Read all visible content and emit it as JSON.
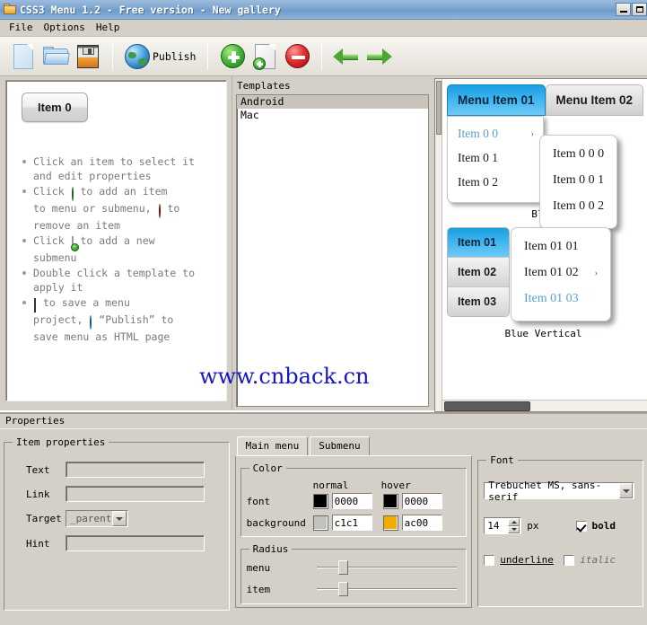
{
  "window": {
    "title": "CSS3 Menu 1.2 - Free version - New gallery",
    "icon": "folder-icon",
    "minimize_label": "minimize-icon",
    "maximize_label": "maximize-icon"
  },
  "menubar": {
    "items": [
      "File",
      "Options",
      "Help"
    ]
  },
  "toolbar": {
    "new_icon": "new-document-icon",
    "open_icon": "open-folder-icon",
    "save_icon": "save-disk-icon",
    "publish_icon": "globe-icon",
    "publish_label": "Publish",
    "add_item_icon": "add-item-icon",
    "add_submenu_icon": "add-submenu-icon",
    "remove_item_icon": "remove-item-icon",
    "back_icon": "arrow-left-icon",
    "forward_icon": "arrow-right-icon"
  },
  "help_panel": {
    "preview_button": "Item 0",
    "tips": [
      {
        "parts": [
          "Click an item to select it and edit properties"
        ]
      },
      {
        "parts": [
          "Click ",
          "[add-icon]",
          " to add an item to menu or submenu, ",
          "[remove-icon]",
          " to remove an item"
        ]
      },
      {
        "parts": [
          "Click ",
          "[new-submenu-icon]",
          " to add a new submenu"
        ]
      },
      {
        "parts": [
          "Double click a template to apply it"
        ]
      },
      {
        "parts": [
          "[save-icon]",
          " to save a menu project, ",
          "[globe-icon]",
          " “Publish” to save menu as HTML page"
        ]
      }
    ],
    "tip_1_a": "Click an item to select it",
    "tip_1_b": "and edit properties",
    "tip_2_pre": "Click",
    "tip_2_mid": "to add an item",
    "tip_2_l2a": "to menu or submenu,",
    "tip_2_l2b": "to",
    "tip_2_l3": "remove an item",
    "tip_3_pre": "Click",
    "tip_3_mid": "to add a new",
    "tip_3_l2": "submenu",
    "tip_4_a": "Double click a template to",
    "tip_4_b": "apply it",
    "tip_5_a": "to save a menu",
    "tip_5_b": "project,",
    "tip_5_c": "“Publish” to",
    "tip_5_d": "save menu as HTML page"
  },
  "templates": {
    "header": "Templates",
    "items": [
      {
        "name": "Android",
        "selected": true
      },
      {
        "name": "Mac",
        "selected": false
      }
    ]
  },
  "gallery": {
    "horizontal_demo": {
      "caption": "Blue",
      "tabs": [
        {
          "label": "Menu Item 01",
          "state": "active"
        },
        {
          "label": "Menu Item 02",
          "state": "normal"
        }
      ],
      "dropdown": [
        {
          "label": "Item 0 0",
          "highlighted": true,
          "has_arrow": true,
          "arrow": "›"
        },
        {
          "label": "Item 0 1",
          "highlighted": false,
          "has_arrow": false
        },
        {
          "label": "Item 0 2",
          "highlighted": false,
          "has_arrow": false
        }
      ],
      "submenu": [
        {
          "label": "Item 0 0 0"
        },
        {
          "label": "Item 0 0 1"
        },
        {
          "label": "Item 0 0 2"
        }
      ]
    },
    "vertical_demo": {
      "caption": "Blue Vertical",
      "items": [
        {
          "label": "Item 01",
          "state": "active"
        },
        {
          "label": "Item 02",
          "state": "normal"
        },
        {
          "label": "Item 03",
          "state": "normal"
        }
      ],
      "submenu": [
        {
          "label": "Item 01 01",
          "highlighted": false,
          "has_arrow": false
        },
        {
          "label": "Item 01 02",
          "highlighted": false,
          "has_arrow": true,
          "arrow": "›"
        },
        {
          "label": "Item 01 03",
          "highlighted": true,
          "has_arrow": false
        }
      ]
    }
  },
  "watermark": "www.cnback.cn",
  "properties": {
    "header": "Properties",
    "item_properties": {
      "legend": "Item properties",
      "fields": [
        {
          "label": "Text",
          "value": ""
        },
        {
          "label": "Link",
          "value": ""
        }
      ],
      "target_label": "Target",
      "target_value": "_parent",
      "hint_label": "Hint",
      "hint_value": ""
    },
    "tabs": [
      {
        "label": "Main menu",
        "active": true
      },
      {
        "label": "Submenu",
        "active": false
      }
    ],
    "color": {
      "legend": "Color",
      "col_normal": "normal",
      "col_hover": "hover",
      "rows": [
        {
          "label": "font",
          "normal_swatch": "#000000",
          "normal_hex": "0000",
          "hover_swatch": "#000000",
          "hover_hex": "0000"
        },
        {
          "label": "background",
          "normal_swatch": "#c1c1c1",
          "normal_hex": "c1c1",
          "hover_swatch": "#f5ac00",
          "hover_hex": "ac00"
        }
      ]
    },
    "radius": {
      "legend": "Radius",
      "rows": [
        {
          "label": "menu",
          "percent": 12
        },
        {
          "label": "item",
          "percent": 12
        }
      ]
    },
    "font": {
      "legend": "Font",
      "family": "Trebuchet MS, sans-serif",
      "size": "14",
      "size_unit": "px",
      "bold_label": "bold",
      "bold_checked": true,
      "underline_label": "underline",
      "underline_checked": false,
      "italic_label": "italic",
      "italic_checked": false
    }
  },
  "colors": {
    "window_bg": "#d4d0c8",
    "title_blue": "#7ba4d0",
    "accent_blue": "#1a9ee2",
    "highlight_text": "#5a9fd4",
    "watermark": "#1515cc"
  }
}
